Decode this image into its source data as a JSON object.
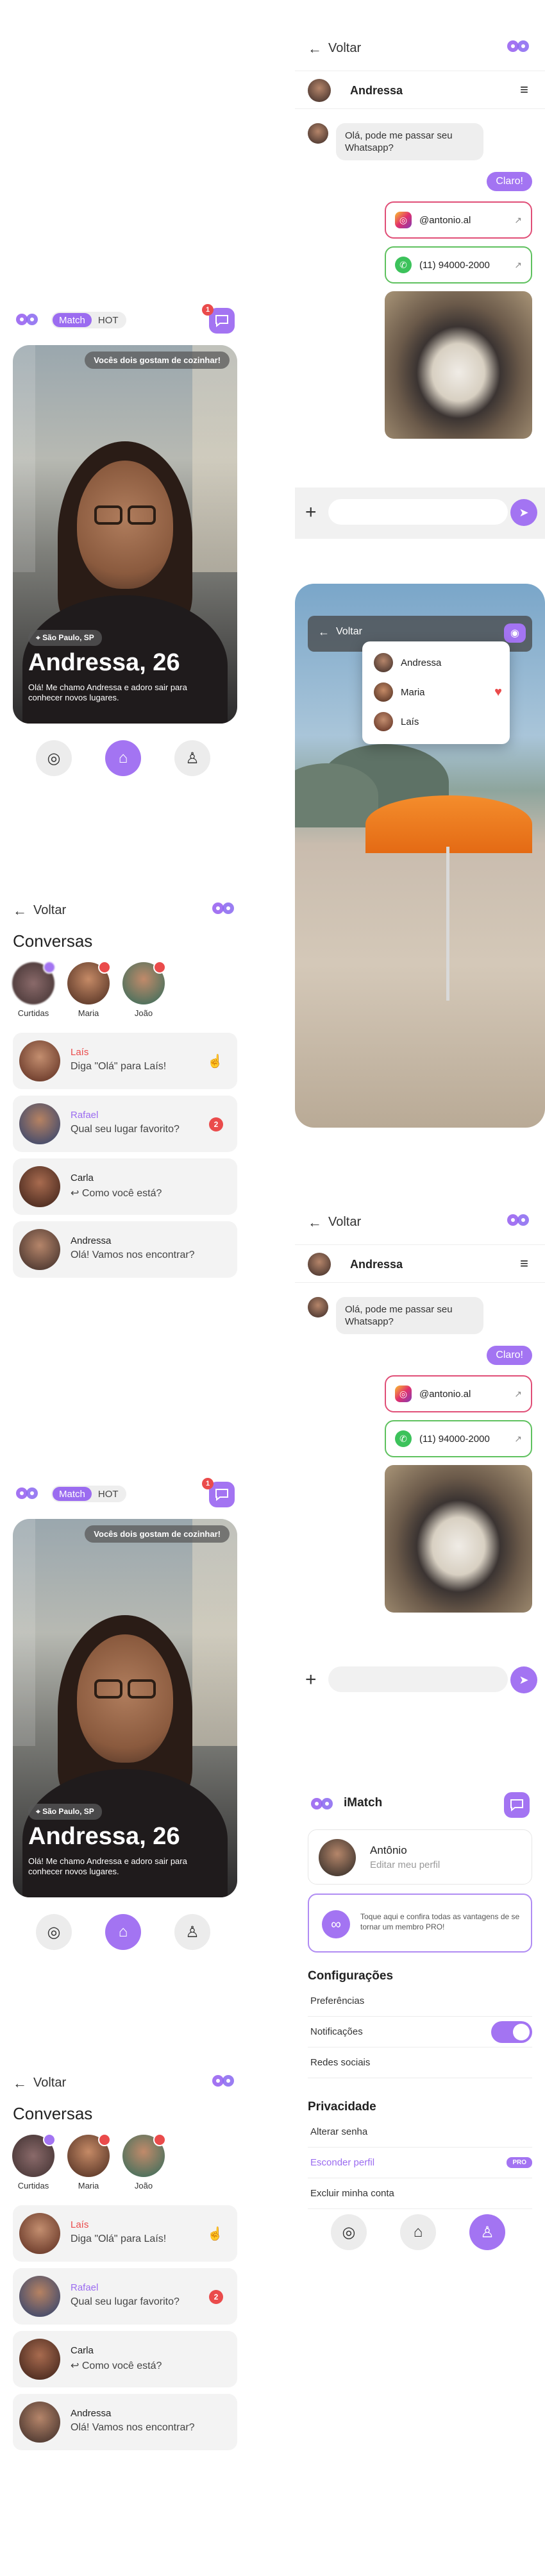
{
  "colors": {
    "accent": "#a374f2",
    "alert": "#ea4b4b",
    "whatsapp": "#3cc25b",
    "instagram_border": "#e04e77",
    "whatsapp_border": "#5ec15e"
  },
  "common": {
    "back_label": "Voltar"
  },
  "match": {
    "toggle": [
      "Match",
      "HOT"
    ],
    "chat_badge": "1",
    "topic": "Vocês dois gostam de cozinhar!",
    "location": "São Paulo, SP",
    "name": "Andressa, 26",
    "bio": "Olá! Me chamo Andressa e adoro sair para conhecer novos lugares."
  },
  "conversations": {
    "title": "Conversas",
    "stories": [
      "Curtidas",
      "Maria",
      "João"
    ],
    "items": [
      {
        "name": "Laís",
        "message": "Diga \"Olá\" para Laís!"
      },
      {
        "name": "Rafael",
        "message": "Qual seu lugar favorito?",
        "badge": "2"
      },
      {
        "name": "Carla",
        "message": "Como você está?"
      },
      {
        "name": "Andressa",
        "message": "Olá! Vamos nos encontrar?"
      }
    ]
  },
  "chat": {
    "contact_name": "Andressa",
    "incoming": "Olá, pode me passar seu Whatsapp?",
    "reply": "Claro!",
    "instagram": "@antonio.al",
    "whatsapp": "(11) 94000-2000"
  },
  "beach": {
    "people": [
      "Andressa",
      "Maria",
      "Laís"
    ]
  },
  "profile": {
    "app_name": "iMatch",
    "user_name": "Antônio",
    "edit_profile": "Editar meu perfil",
    "pro_text": "Toque aqui e confira todas as vantagens de se tornar um membro PRO!",
    "settings_title": "Configurações",
    "settings": [
      "Preferências",
      "Notificações",
      "Redes sociais"
    ],
    "privacy_title": "Privacidade",
    "privacy": [
      "Alterar senha",
      "Esconder perfil",
      "Excluir minha conta"
    ],
    "pro_badge": "PRO",
    "notifications_on": true
  }
}
